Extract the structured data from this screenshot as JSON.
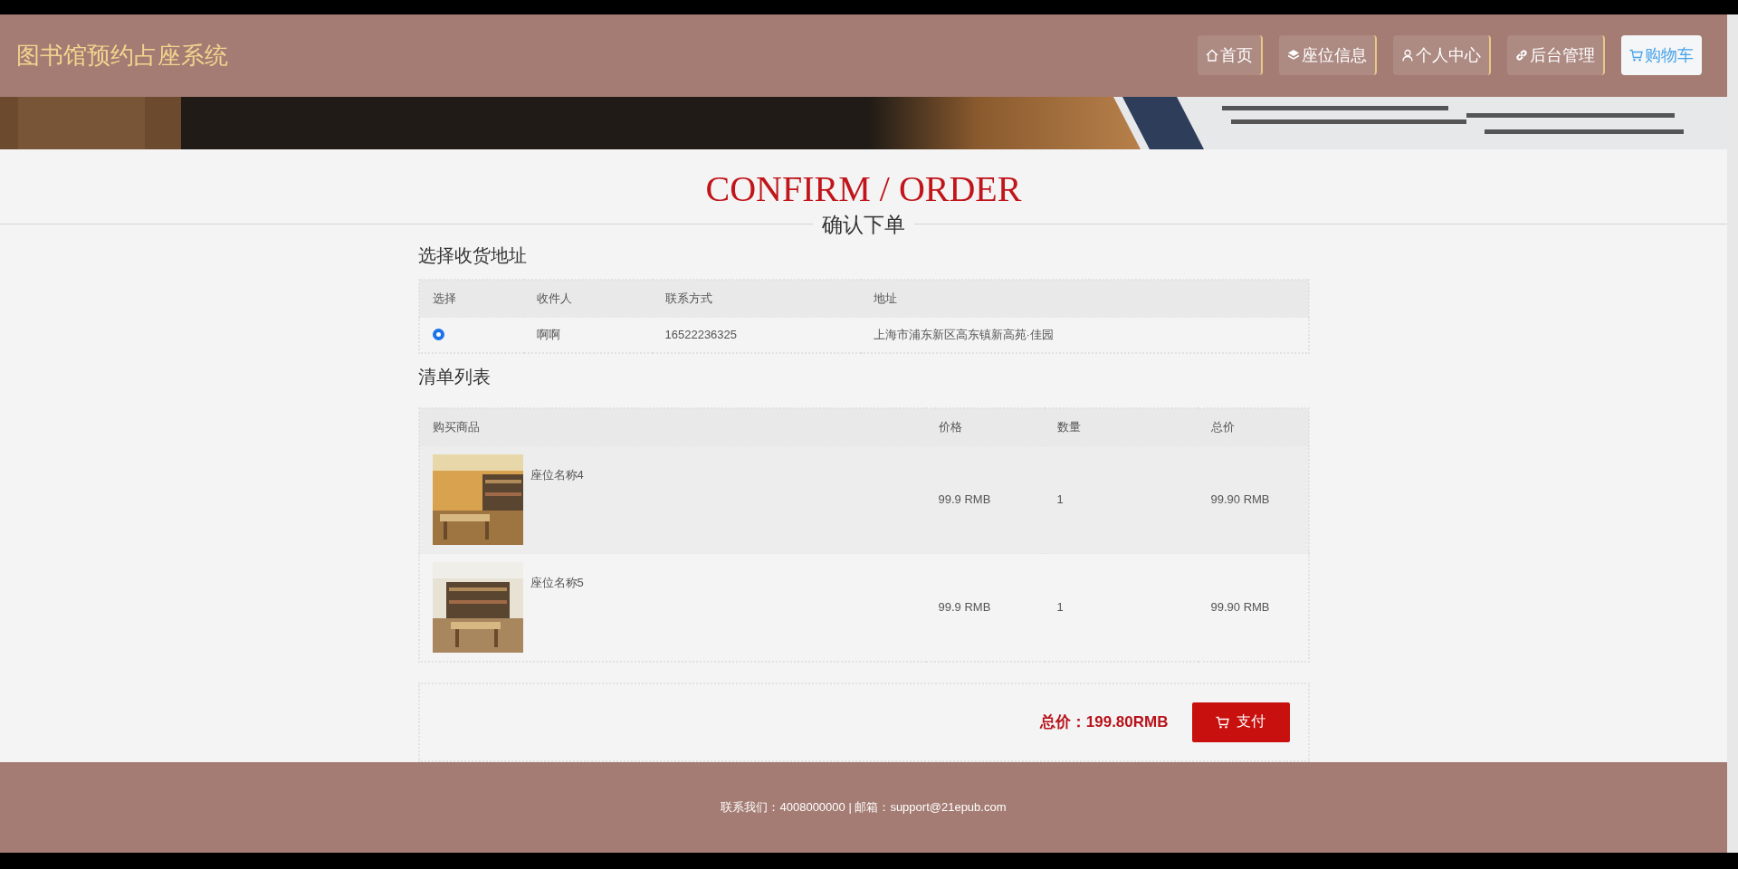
{
  "header": {
    "title": "图书馆预约占座系统",
    "nav": [
      {
        "label": "首页",
        "kind": "home",
        "selected": false
      },
      {
        "label": "座位信息",
        "kind": "layers",
        "selected": false
      },
      {
        "label": "个人中心",
        "kind": "person",
        "selected": false
      },
      {
        "label": "后台管理",
        "kind": "link",
        "selected": false
      },
      {
        "label": "购物车",
        "kind": "cart",
        "selected": true
      }
    ]
  },
  "heading": {
    "title": "CONFIRM / ORDER",
    "subtitle": "确认下单"
  },
  "address": {
    "title": "选择收货地址",
    "columns": [
      "选择",
      "收件人",
      "联系方式",
      "地址"
    ],
    "rows": [
      {
        "selected": true,
        "name": "啊啊",
        "phone": "16522236325",
        "address": "上海市浦东新区高东镇新高苑·佳园"
      }
    ]
  },
  "items": {
    "title": "清单列表",
    "columns": [
      "购买商品",
      "价格",
      "数量",
      "总价"
    ],
    "rows": [
      {
        "name": "座位名称4",
        "price": "99.9 RMB",
        "quantity": "1",
        "total": "99.90 RMB"
      },
      {
        "name": "座位名称5",
        "price": "99.9 RMB",
        "quantity": "1",
        "total": "99.90 RMB"
      }
    ]
  },
  "summary": {
    "total": "总价：199.80RMB",
    "pay_button": "支付"
  },
  "footer": {
    "text": "联系我们：4008000000 | 邮箱：support@21epub.com"
  }
}
